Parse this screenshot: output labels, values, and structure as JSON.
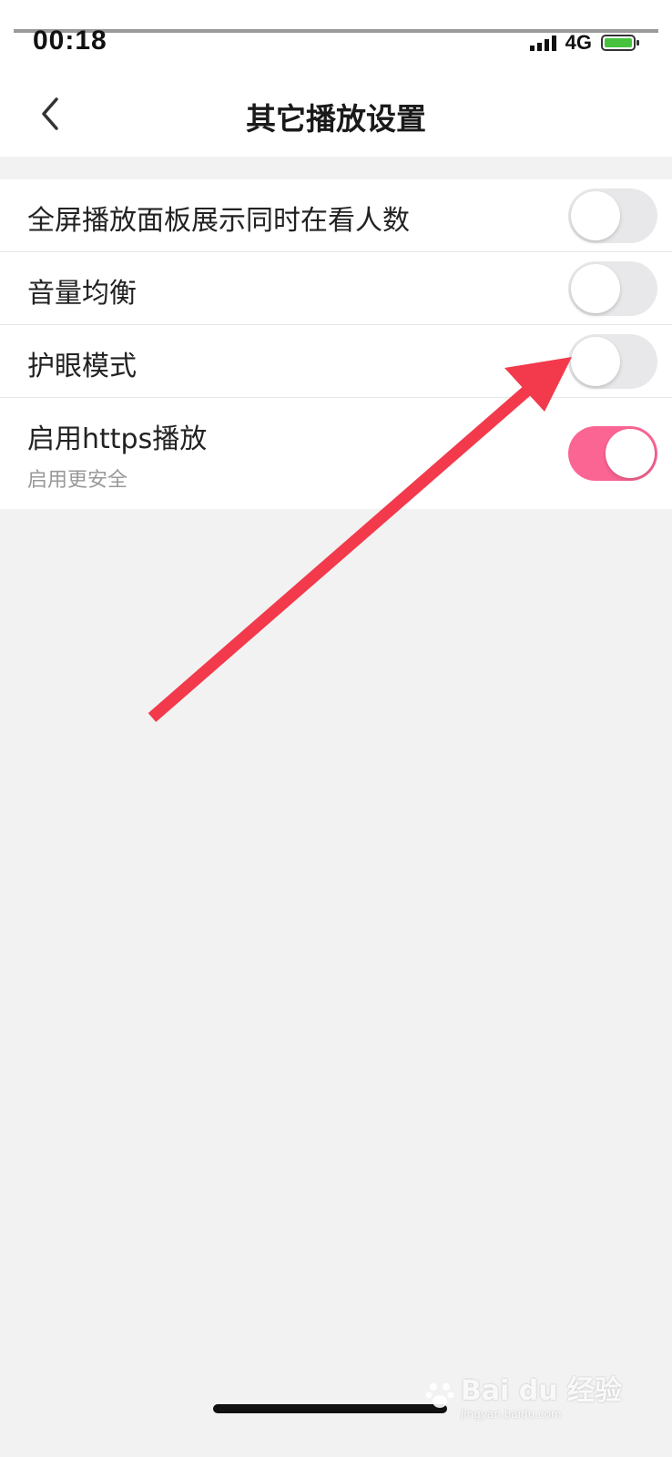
{
  "status_bar": {
    "time": "00:18",
    "network": "4G",
    "icons": [
      "location-arrow-icon",
      "signal-icon",
      "battery-charging-icon"
    ]
  },
  "nav": {
    "title": "其它播放设置",
    "back_icon": "chevron-left-icon"
  },
  "settings": [
    {
      "label": "全屏播放面板展示同时在看人数",
      "enabled": false
    },
    {
      "label": "音量均衡",
      "enabled": false
    },
    {
      "label": "护眼模式",
      "enabled": false
    },
    {
      "label": "启用https播放",
      "subtitle": "启用更安全",
      "enabled": true
    }
  ],
  "colors": {
    "toggle_on": "#fb6593",
    "toggle_off": "#e8e8ea",
    "annotation_arrow": "#f23a4c"
  },
  "watermark": {
    "brand": "Bai du 经验",
    "url": "jingyan.baidu.com"
  }
}
